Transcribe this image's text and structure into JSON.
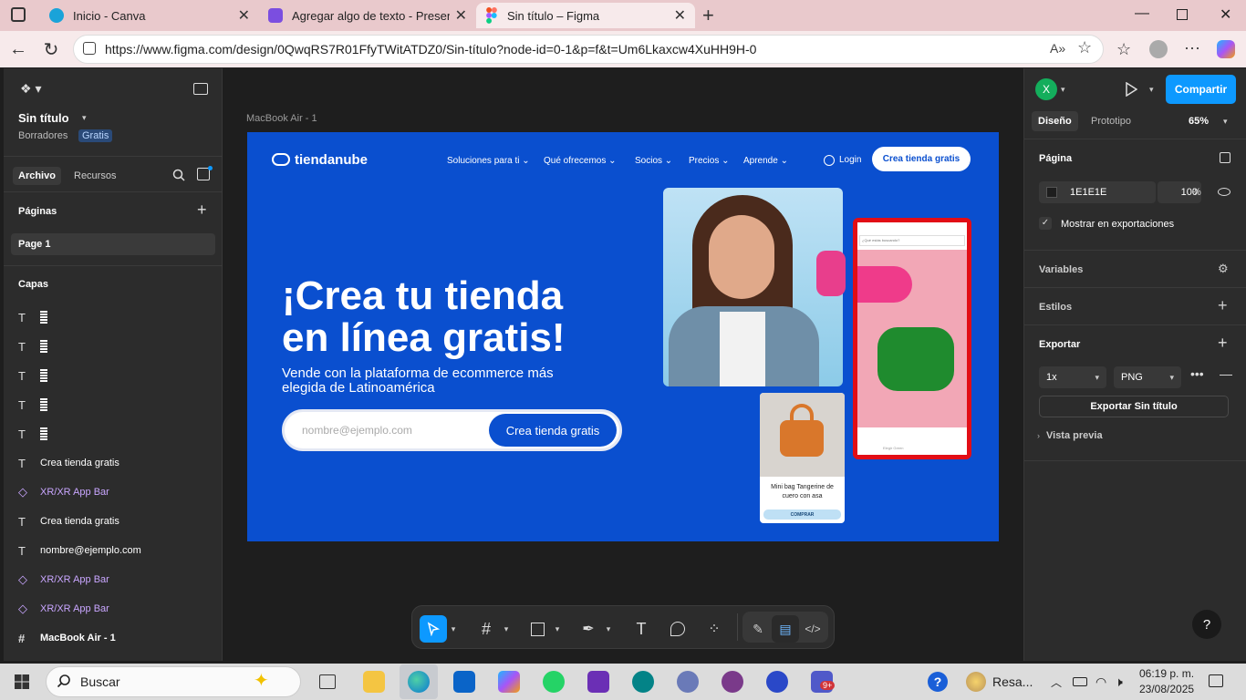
{
  "browser": {
    "tabs": [
      {
        "title": "Inicio - Canva",
        "color": "#1aa3d9"
      },
      {
        "title": "Agregar algo de texto - Presentac",
        "color": "#7b4ee0"
      },
      {
        "title": "Sin título – Figma",
        "color": "#f24e1e"
      }
    ],
    "url": "https://www.figma.com/design/0QwqRS7R01FfyTWitATDZ0/Sin-título?node-id=0-1&p=f&t=Um6Lkaxcw4XuHH9H-0"
  },
  "left_panel": {
    "file_name": "Sin título",
    "drafts": "Borradores",
    "plan_badge": "Gratis",
    "tab_file": "Archivo",
    "tab_resources": "Recursos",
    "pages_title": "Páginas",
    "page_1": "Page 1",
    "layers_title": "Capas",
    "layers": [
      {
        "icon": "text-icon",
        "label": ""
      },
      {
        "icon": "text-icon",
        "label": ""
      },
      {
        "icon": "text-icon",
        "label": ""
      },
      {
        "icon": "text-icon",
        "label": ""
      },
      {
        "icon": "text-icon",
        "label": ""
      },
      {
        "icon": "text-icon",
        "label": "Crea tienda gratis"
      },
      {
        "icon": "component-icon",
        "label": "XR/XR App Bar"
      },
      {
        "icon": "text-icon",
        "label": "Crea tienda gratis"
      },
      {
        "icon": "text-icon",
        "label": "nombre@ejemplo.com"
      },
      {
        "icon": "component-icon",
        "label": "XR/XR App Bar"
      },
      {
        "icon": "component-icon",
        "label": "XR/XR App Bar"
      },
      {
        "icon": "frame-icon",
        "label": "MacBook Air - 1"
      }
    ]
  },
  "canvas": {
    "frame_label": "MacBook Air - 1",
    "site": {
      "logo": "tiendanube",
      "nav": [
        "Soluciones para ti",
        "Qué ofrecemos",
        "Socios",
        "Precios",
        "Aprende"
      ],
      "login": "Login",
      "cta_top": "Crea tienda gratis",
      "headline_1": "¡Crea tu tienda",
      "headline_2": "en línea gratis!",
      "subtitle_1": "Vende con la plataforma de ecommerce más",
      "subtitle_2": "elegida de Latinoamérica",
      "email_placeholder": "nombre@ejemplo.com",
      "cta_form": "Crea tienda gratis",
      "product_name_1": "Mini bag Tangerine de",
      "product_name_2": "cuero con asa",
      "product_buy": "COMPRAR",
      "phone_search": "¿Qué estás buscando?",
      "phone_button": "Elegir Green"
    }
  },
  "toolbar": {
    "tools": [
      "move-icon",
      "frame-icon",
      "rectangle-icon",
      "pen-icon",
      "text-tool-icon",
      "comment-icon",
      "actions-icon",
      "draw-icon",
      "dev-mode-icon",
      "code-icon"
    ]
  },
  "right_panel": {
    "avatar_letter": "X",
    "share": "Compartir",
    "tab_design": "Diseño",
    "tab_prototype": "Prototipo",
    "zoom": "65%",
    "page_title": "Página",
    "bg_color": "1E1E1E",
    "bg_opacity": "100",
    "percent": "%",
    "show_in_exports": "Mostrar en exportaciones",
    "variables": "Variables",
    "styles": "Estilos",
    "export_title": "Exportar",
    "export_scale": "1x",
    "export_format": "PNG",
    "export_button": "Exportar Sin título",
    "preview": "Vista previa",
    "help": "?"
  },
  "taskbar": {
    "search": "Buscar",
    "weather": "Resa...",
    "time": "06:19 p. m.",
    "date": "23/08/2025",
    "teams_badge": "9+"
  }
}
